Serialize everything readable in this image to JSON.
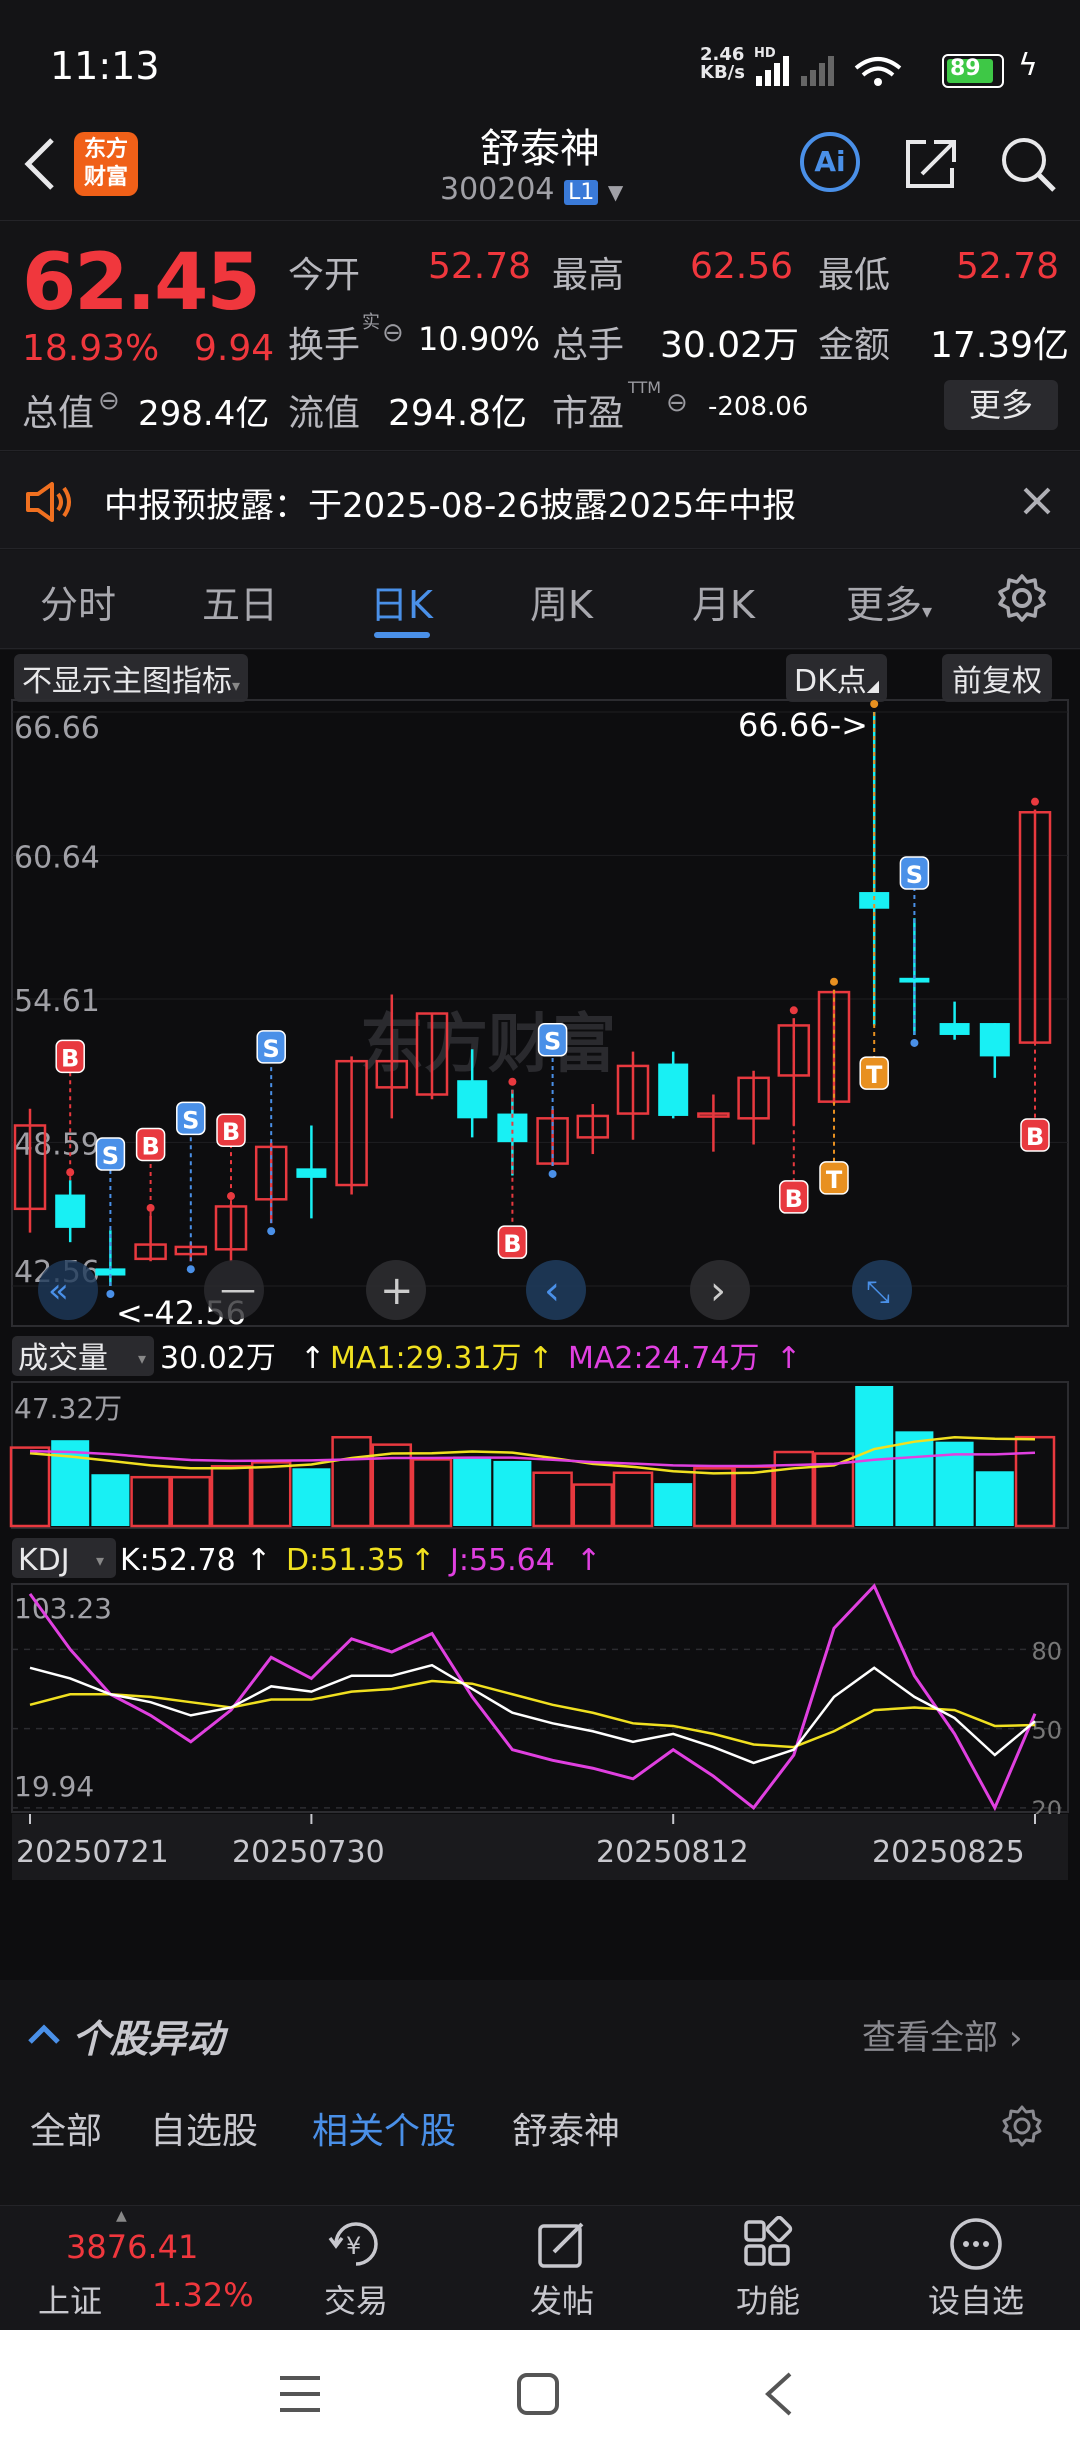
{
  "status_bar": {
    "time": "11:13",
    "net_speed": "2.46",
    "net_unit": "KB/s",
    "hd": "HD",
    "battery": "89"
  },
  "nav": {
    "title": "舒泰神",
    "code": "300204",
    "level_badge": "L1",
    "logo_text_1": "东方",
    "logo_text_2": "财富",
    "ai_label": "Ai"
  },
  "quote": {
    "price": "62.45",
    "change_pct": "18.93%",
    "change": "9.94",
    "labels": {
      "open": "今开",
      "high": "最高",
      "low": "最低",
      "turnover": "换手",
      "turnover_sup": "实",
      "volume": "总手",
      "amount": "金额",
      "total_cap": "总值",
      "float_cap": "流值",
      "pe": "市盈",
      "pe_sup": "TTM"
    },
    "open": "52.78",
    "high": "62.56",
    "low": "52.78",
    "turnover": "10.90%",
    "volume": "30.02万",
    "amount": "17.39亿",
    "total_cap": "298.4亿",
    "float_cap": "294.8亿",
    "pe": "-208.06",
    "more_button": "更多"
  },
  "notice": {
    "text": "中报预披露：于2025-08-26披露2025年中报"
  },
  "tabs": [
    {
      "label": "分时"
    },
    {
      "label": "五日"
    },
    {
      "label": "日K"
    },
    {
      "label": "周K"
    },
    {
      "label": "月K"
    },
    {
      "label": "更多"
    }
  ],
  "chart_toolbar": {
    "indicator": "不显示主图指标",
    "dk": "DK点",
    "adjust": "前复权"
  },
  "chart_data": [
    {
      "type": "candlestick",
      "y_ticks": [
        "66.66",
        "60.64",
        "54.61",
        "48.59",
        "42.56"
      ],
      "ylim": [
        42.56,
        66.66
      ],
      "max_label": "66.66->",
      "min_label": "<-42.56",
      "watermark": "东方财富",
      "candles": [
        {
          "o": 45.8,
          "h": 50.0,
          "l": 44.8,
          "c": 49.3
        },
        {
          "o": 46.4,
          "h": 47.0,
          "l": 44.4,
          "c": 45.0
        },
        {
          "o": 43.3,
          "h": 44.9,
          "l": 42.56,
          "c": 43.0
        },
        {
          "o": 43.7,
          "h": 45.5,
          "l": 43.6,
          "c": 44.3
        },
        {
          "o": 43.9,
          "h": 44.4,
          "l": 43.6,
          "c": 44.2
        },
        {
          "o": 44.1,
          "h": 46.0,
          "l": 43.6,
          "c": 45.9
        },
        {
          "o": 46.2,
          "h": 48.6,
          "l": 45.2,
          "c": 48.4
        },
        {
          "o": 47.5,
          "h": 49.3,
          "l": 45.4,
          "c": 47.1
        },
        {
          "o": 46.8,
          "h": 52.2,
          "l": 46.4,
          "c": 52.0
        },
        {
          "o": 50.9,
          "h": 54.8,
          "l": 49.6,
          "c": 52.0
        },
        {
          "o": 50.6,
          "h": 54.0,
          "l": 50.4,
          "c": 54.0
        },
        {
          "o": 51.2,
          "h": 52.5,
          "l": 48.8,
          "c": 49.6
        },
        {
          "o": 49.8,
          "h": 50.8,
          "l": 47.2,
          "c": 48.6
        },
        {
          "o": 47.7,
          "h": 50.0,
          "l": 47.6,
          "c": 49.6
        },
        {
          "o": 48.8,
          "h": 50.2,
          "l": 48.1,
          "c": 49.7
        },
        {
          "o": 49.8,
          "h": 52.4,
          "l": 48.7,
          "c": 51.8
        },
        {
          "o": 51.9,
          "h": 52.4,
          "l": 49.6,
          "c": 49.7
        },
        {
          "o": 49.8,
          "h": 50.6,
          "l": 48.2,
          "c": 49.8
        },
        {
          "o": 49.6,
          "h": 51.6,
          "l": 48.5,
          "c": 51.3
        },
        {
          "o": 51.4,
          "h": 53.8,
          "l": 49.3,
          "c": 53.5
        },
        {
          "o": 50.3,
          "h": 55.0,
          "l": 50.2,
          "c": 54.9
        },
        {
          "o": 59.1,
          "h": 66.66,
          "l": 53.5,
          "c": 58.4
        },
        {
          "o": 55.5,
          "h": 58.0,
          "l": 53.1,
          "c": 55.3
        },
        {
          "o": 53.6,
          "h": 54.5,
          "l": 52.9,
          "c": 53.1
        },
        {
          "o": 53.6,
          "h": 53.6,
          "l": 51.3,
          "c": 52.2
        },
        {
          "o": 52.78,
          "h": 62.56,
          "l": 52.78,
          "c": 62.45
        }
      ],
      "signals": [
        {
          "i": 1,
          "t": "B",
          "at": 52.2
        },
        {
          "i": 2,
          "t": "S",
          "at": 48.1
        },
        {
          "i": 3,
          "t": "B",
          "at": 48.5
        },
        {
          "i": 4,
          "t": "S",
          "at": 49.6
        },
        {
          "i": 5,
          "t": "B",
          "at": 49.1
        },
        {
          "i": 6,
          "t": "S",
          "at": 52.6
        },
        {
          "i": 12,
          "t": "B",
          "at": 44.4
        },
        {
          "i": 13,
          "t": "S",
          "at": 52.9
        },
        {
          "i": 19,
          "t": "B",
          "at": 46.3
        },
        {
          "i": 20,
          "t": "T",
          "at": 47.1
        },
        {
          "i": 21,
          "t": "T",
          "at": 51.5
        },
        {
          "i": 22,
          "t": "S",
          "at": 59.9
        },
        {
          "i": 25,
          "t": "B",
          "at": 48.9
        }
      ]
    },
    {
      "type": "bar",
      "title": "成交量",
      "current": "30.02万",
      "ma1_label": "MA1:29.31万",
      "ma2_label": "MA2:24.74万",
      "y_max_label": "47.32万",
      "ylim": [
        0,
        47.32
      ],
      "values": [
        26.5,
        29.0,
        17.5,
        16.5,
        16.5,
        20.2,
        21.5,
        19.5,
        30.0,
        27.5,
        22.5,
        23.5,
        22.0,
        18.0,
        14.0,
        18.0,
        14.5,
        19.5,
        20.0,
        25.0,
        24.5,
        47.32,
        32.0,
        28.5,
        18.5,
        30.02
      ],
      "ma1": [
        24.6,
        23.5,
        22.0,
        20.5,
        19.5,
        19.5,
        20.0,
        20.8,
        23.0,
        24.5,
        24.6,
        25.2,
        24.8,
        23.0,
        21.0,
        20.0,
        18.5,
        17.8,
        18.0,
        19.5,
        20.5,
        26.0,
        28.5,
        30.0,
        29.5,
        29.31
      ],
      "ma2": [
        25.3,
        25.0,
        24.3,
        23.2,
        22.3,
        22.0,
        22.1,
        22.2,
        22.5,
        23.0,
        23.0,
        23.1,
        23.1,
        22.4,
        21.6,
        21.1,
        20.5,
        20.3,
        20.3,
        20.6,
        21.0,
        22.4,
        23.3,
        24.2,
        24.2,
        24.74
      ]
    },
    {
      "type": "line",
      "title": "KDJ",
      "k_label": "K:52.78",
      "d_label": "D:51.35",
      "j_label": "J:55.64",
      "y_max_label": "103.23",
      "y_min_label": "19.94",
      "ref_levels": [
        "80",
        "50",
        "20"
      ],
      "ylim": [
        19.94,
        103.23
      ],
      "K": [
        73,
        69,
        63,
        60,
        55,
        58,
        66,
        64,
        70,
        70,
        74,
        65,
        56,
        52,
        49,
        45,
        48,
        43,
        37,
        42,
        62,
        73,
        62,
        54,
        40,
        52.78
      ],
      "D": [
        59,
        63,
        63,
        62,
        60,
        58,
        61,
        61,
        64,
        65,
        68,
        67,
        63,
        59,
        56,
        52,
        51,
        48,
        44,
        43,
        49,
        57,
        58,
        57,
        51,
        51.35
      ],
      "J": [
        101,
        80,
        63,
        55,
        45,
        57,
        77,
        69,
        84,
        79,
        86,
        62,
        42,
        38,
        35,
        31,
        42,
        32,
        20,
        40,
        88,
        104,
        70,
        48,
        20,
        55.64
      ],
      "x_tick_labels": [
        "20250721",
        "20250730",
        "20250812",
        "20250825"
      ]
    }
  ],
  "section": {
    "title": "个股异动",
    "view_all": "查看全部"
  },
  "filters": [
    "全部",
    "自选股",
    "相关个股",
    "舒泰神"
  ],
  "bottom_bar": {
    "index_value": "3876.41",
    "index_name": "上证",
    "index_change": "1.32%",
    "items": [
      {
        "label": "交易"
      },
      {
        "label": "发帖"
      },
      {
        "label": "功能"
      },
      {
        "label": "设自选"
      }
    ]
  },
  "colors": {
    "up": "#e8393f",
    "down": "#18f0f4",
    "accent": "#4a90e8",
    "yellow": "#f0e020",
    "magenta": "#e040e0",
    "orange": "#e89020"
  }
}
